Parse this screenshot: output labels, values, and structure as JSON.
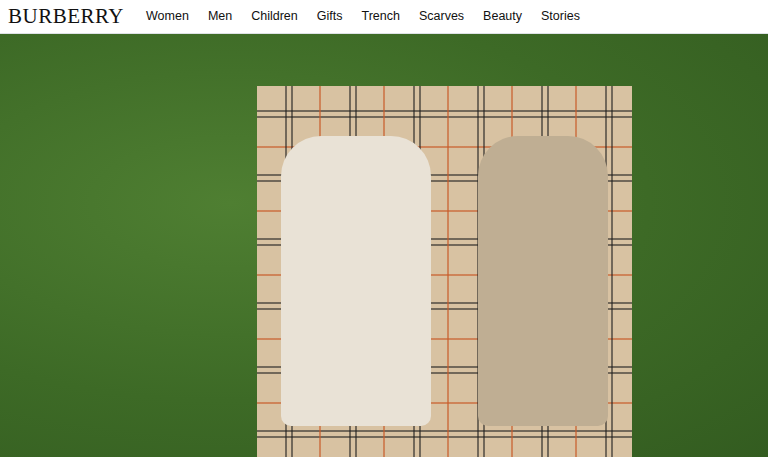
{
  "header": {
    "logo": "BURBERRY",
    "nav": [
      "Women",
      "Men",
      "Children",
      "Gifts",
      "Trench",
      "Scarves",
      "Beauty",
      "Stories"
    ]
  }
}
